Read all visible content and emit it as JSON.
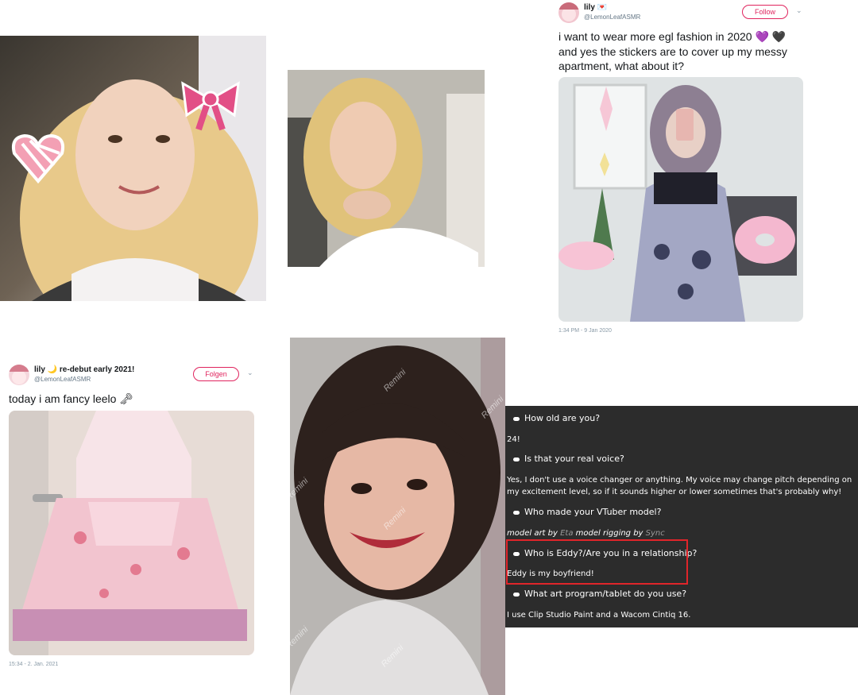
{
  "tweet_top": {
    "name": "lily",
    "name_emoji": "💌",
    "handle": "@LemonLeafASMR",
    "follow_label": "Follow",
    "text": "i want to wear more egl fashion in 2020 💜 🖤 and yes the stickers are to cover up my messy apartment, what about it?",
    "timestamp": "1:34 PM - 9 Jan 2020"
  },
  "tweet_bottom": {
    "name": "lily 🌙 re-debut early 2021!",
    "handle": "@LemonLeafASMR",
    "follow_label": "Folgen",
    "text": "today i am fancy leelo 🗝",
    "timestamp": "15:34 - 2. Jan. 2021"
  },
  "watermark": "Remini",
  "faq": {
    "items": [
      {
        "q": "How old are you?",
        "a": "24!"
      },
      {
        "q": "Is that your real voice?",
        "a": "Yes, I don't use a voice changer or anything. My voice may change pitch depending on my excitement level, so if it sounds higher or lower sometimes that's probably why!"
      },
      {
        "q": "Who made your VTuber model?",
        "a_parts": [
          "model art by ",
          "Eta",
          " model rigging by ",
          "Sync"
        ]
      },
      {
        "q": "Who is Eddy?/Are you in a relationship?",
        "a": "Eddy is my boyfriend!"
      },
      {
        "q": "What art program/tablet do you use?",
        "a": "I use Clip Studio Paint and a Wacom Cintiq 16."
      }
    ]
  },
  "colors": {
    "highlight": "#e0252a",
    "follow": "#e0245e",
    "faq_bg": "#2c2c2c"
  }
}
